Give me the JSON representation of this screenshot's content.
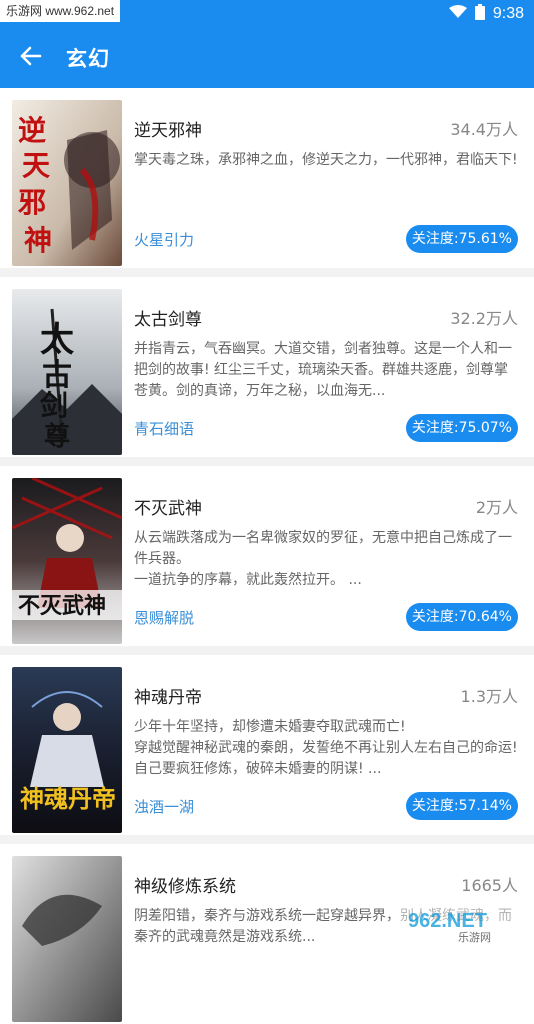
{
  "status_bar": {
    "watermark_text": "乐游网 www.962.net",
    "time": "9:38"
  },
  "header": {
    "title": "玄幻",
    "back_icon": "arrow-left-icon"
  },
  "books": [
    {
      "title": "逆天邪神",
      "readers": "34.4万人",
      "description": "掌天毒之珠，承邪神之血，修逆天之力，一代邪神，君临天下!",
      "author": "火星引力",
      "attention": "关注度:75.61%",
      "cover_text": "逆天邪神"
    },
    {
      "title": "太古剑尊",
      "readers": "32.2万人",
      "description": "并指青云，气吞幽冥。大道交错，剑者独尊。这是一个人和一把剑的故事! 红尘三千丈，琉璃染天香。群雄共逐鹿，剑尊掌苍黄。剑的真谛，万年之秘，以血海无...",
      "author": "青石细语",
      "attention": "关注度:75.07%",
      "cover_text": "太古剑尊"
    },
    {
      "title": "不灭武神",
      "readers": "2万人",
      "description": "从云端跌落成为一名卑微家奴的罗征，无意中把自己炼成了一件兵器。\n一道抗争的序幕，就此轰然拉开。 ...",
      "author": "恩赐解脱",
      "attention": "关注度:70.64%",
      "cover_text": "不灭武神"
    },
    {
      "title": "神魂丹帝",
      "readers": "1.3万人",
      "description": "少年十年坚持，却惨遭未婚妻夺取武魂而亡!\n穿越觉醒神秘武魂的秦朗，发誓绝不再让别人左右自己的命运! 自己要疯狂修炼，破碎未婚妻的阴谋! ...",
      "author": "浊酒一湖",
      "attention": "关注度:57.14%",
      "cover_text": "神魂丹帝"
    },
    {
      "title": "神级修炼系统",
      "readers": "1665人",
      "description": "阴差阳错，秦齐与游戏系统一起穿越异界，别人凝练武魂，而秦齐的武魂竟然是游戏系统...",
      "author": "",
      "attention": "",
      "cover_text": ""
    }
  ],
  "colors": {
    "primary": "#1a8cf0",
    "author_link": "#3a8fd8"
  },
  "footer_watermark": {
    "brand": "962.NET",
    "sub": "乐游网"
  }
}
